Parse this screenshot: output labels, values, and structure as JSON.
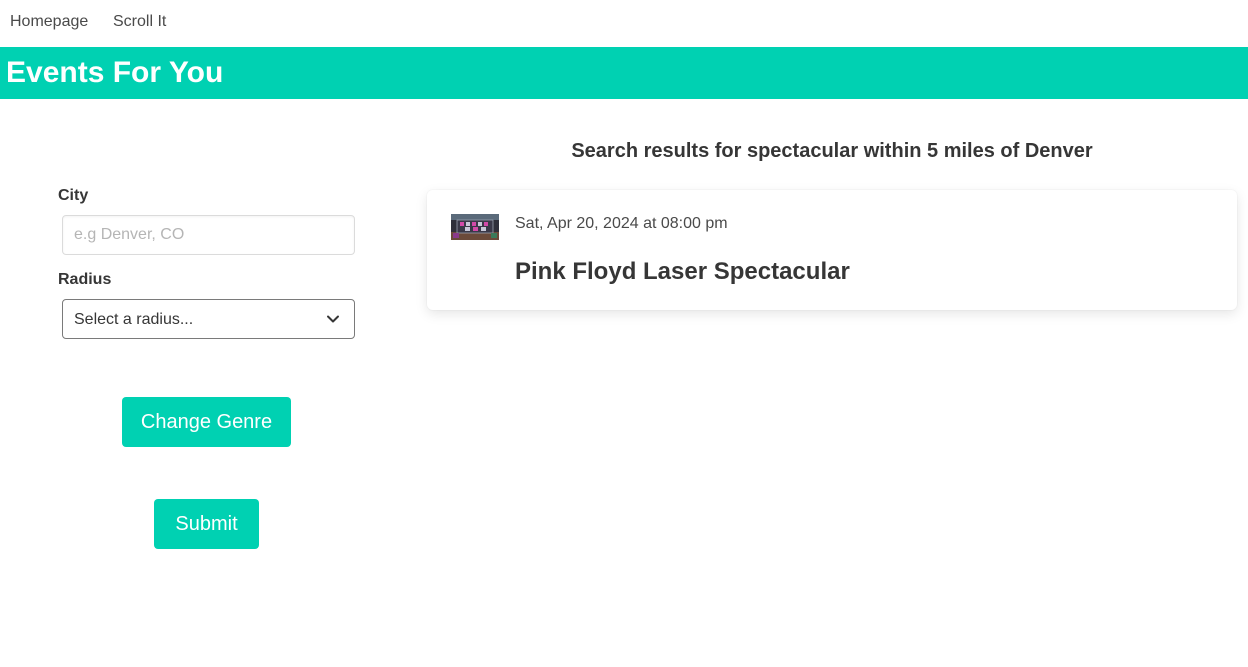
{
  "nav": {
    "items": [
      {
        "label": "Homepage"
      },
      {
        "label": "Scroll It"
      }
    ]
  },
  "banner": {
    "title": "Events For You",
    "color": "#00d1b2"
  },
  "form": {
    "city": {
      "label": "City",
      "value": "",
      "placeholder": "e.g Denver, CO"
    },
    "radius": {
      "label": "Radius",
      "selected": "Select a radius..."
    },
    "change_genre_label": "Change Genre",
    "submit_label": "Submit"
  },
  "results": {
    "heading": "Search results for spectacular within 5 miles of Denver",
    "events": [
      {
        "date": "Sat, Apr 20, 2024 at 08:00 pm",
        "title": "Pink Floyd Laser Spectacular",
        "thumbnail_icon": "event-thumbnail-image"
      }
    ]
  },
  "icons": {
    "radius_dropdown": "chevron-down-icon"
  }
}
